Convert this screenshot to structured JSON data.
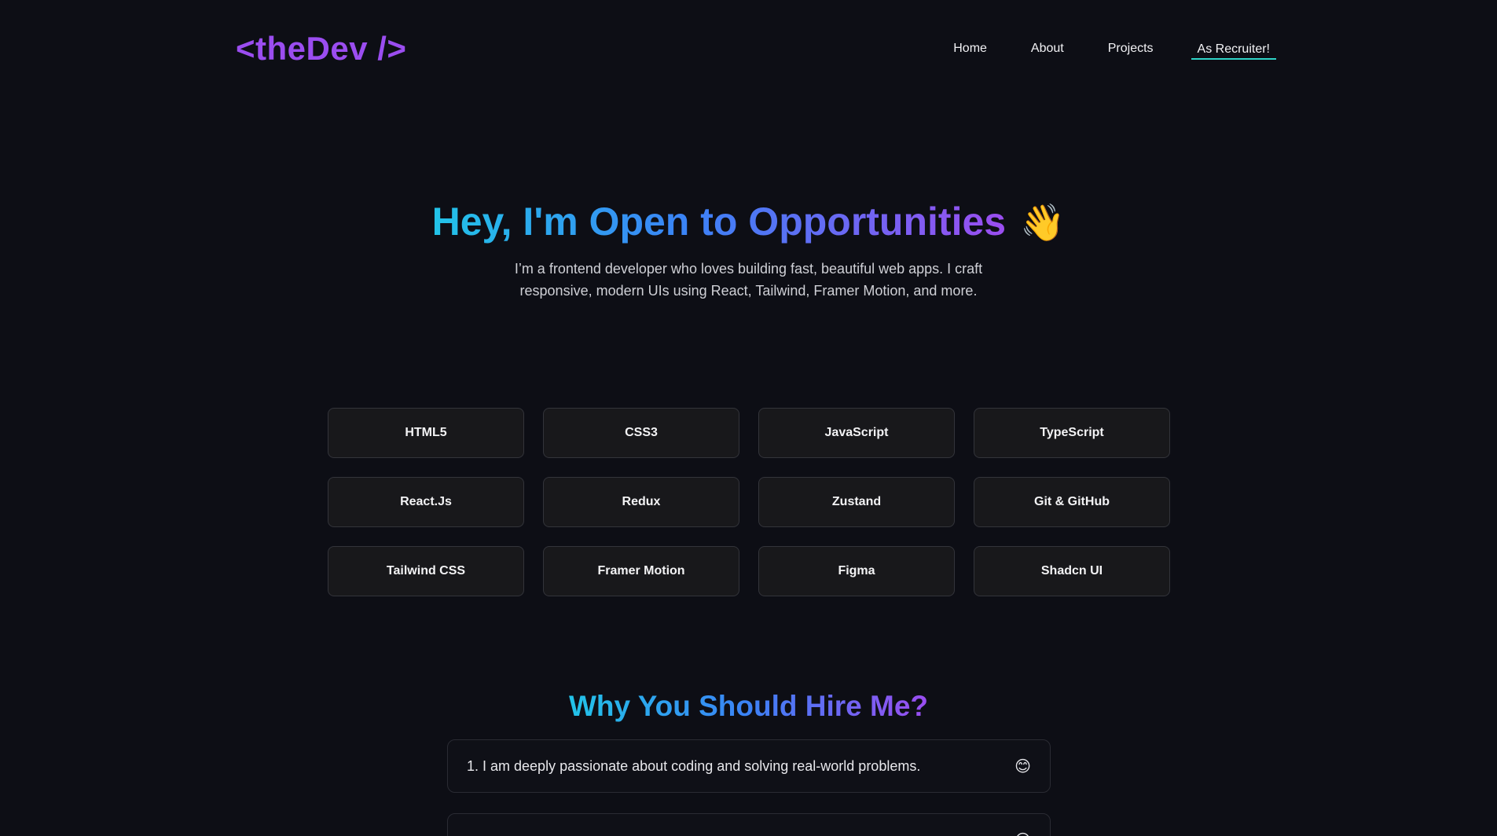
{
  "header": {
    "logo": "<theDev />",
    "nav": [
      {
        "label": "Home"
      },
      {
        "label": "About"
      },
      {
        "label": "Projects"
      },
      {
        "label": "As Recruiter!"
      }
    ]
  },
  "hero": {
    "title": "Hey, I'm Open to Opportunities",
    "emoji": "👋",
    "subtitle_line1": "I’m a frontend developer who loves building fast, beautiful web apps. I craft",
    "subtitle_line2": "responsive, modern UIs using React, Tailwind, Framer Motion, and more."
  },
  "skills": [
    "HTML5",
    "CSS3",
    "JavaScript",
    "TypeScript",
    "React.Js",
    "Redux",
    "Zustand",
    "Git & GitHub",
    "Tailwind CSS",
    "Framer Motion",
    "Figma",
    "Shadcn UI"
  ],
  "why": {
    "title": "Why You Should Hire Me?",
    "reasons": [
      {
        "text": "1. I am deeply passionate about coding and solving real-world problems.",
        "emoji": "😊"
      },
      {
        "text": "",
        "emoji": "😊"
      }
    ]
  },
  "colors": {
    "background": "#0d0e15",
    "logo": "#9b4df0",
    "active_underline": "#2ed3c7",
    "gradient_start": "#22c3e8",
    "gradient_mid": "#3b82f6",
    "gradient_end": "#9b4df0"
  }
}
